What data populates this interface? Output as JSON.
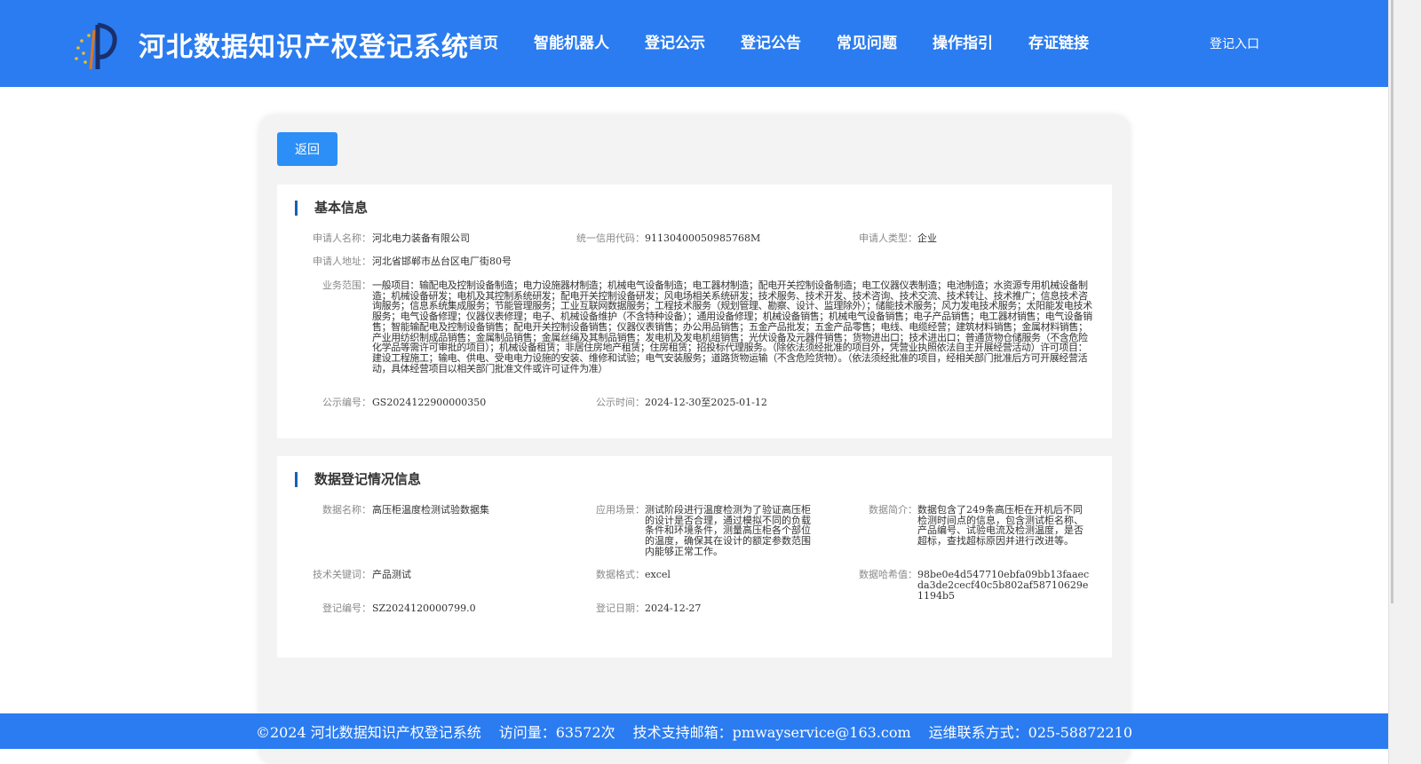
{
  "header": {
    "site_title": "河北数据知识产权登记系统",
    "nav": [
      "首页",
      "智能机器人",
      "登记公示",
      "登记公告",
      "常见问题",
      "操作指引",
      "存证链接"
    ],
    "login": "登记入口"
  },
  "back_button": "返回",
  "basic_info": {
    "title": "基本信息",
    "applicant_name": {
      "label": "申请人名称：",
      "value": "河北电力装备有限公司"
    },
    "credit_code": {
      "label": "统一信用代码：",
      "value": "91130400050985768M"
    },
    "applicant_type": {
      "label": "申请人类型：",
      "value": "企业"
    },
    "address": {
      "label": "申请人地址：",
      "value": "河北省邯郸市丛台区电厂街80号"
    },
    "business_scope": {
      "label": "业务范围：",
      "value": "一般项目：输配电及控制设备制造；电力设施器材制造；机械电气设备制造；电工器材制造；配电开关控制设备制造；电工仪器仪表制造；电池制造；水资源专用机械设备制造；机械设备研发；电机及其控制系统研发；配电开关控制设备研发；风电场相关系统研发；技术服务、技术开发、技术咨询、技术交流、技术转让、技术推广；信息技术咨询服务；信息系统集成服务；节能管理服务；工业互联网数据服务；工程技术服务（规划管理、勘察、设计、监理除外）；储能技术服务；风力发电技术服务；太阳能发电技术服务；电气设备修理；仪器仪表修理；电子、机械设备维护（不含特种设备）；通用设备修理；机械设备销售；机械电气设备销售；电子产品销售；电工器材销售；电气设备销售；智能输配电及控制设备销售；配电开关控制设备销售；仪器仪表销售；办公用品销售；五金产品批发；五金产品零售；电线、电缆经营；建筑材料销售；金属材料销售；产业用纺织制成品销售；金属制品销售；金属丝绳及其制品销售；发电机及发电机组销售；光伏设备及元器件销售；货物进出口；技术进出口；普通货物仓储服务（不含危险化学品等需许可审批的项目）；机械设备租赁；非居住房地产租赁；住房租赁；招投标代理服务。（除依法须经批准的项目外，凭营业执照依法自主开展经营活动）许可项目：建设工程施工；输电、供电、受电电力设施的安装、维修和试验；电气安装服务；道路货物运输（不含危险货物）。（依法须经批准的项目，经相关部门批准后方可开展经营活动，具体经营项目以相关部门批准文件或许可证件为准）"
    },
    "notice_no": {
      "label": "公示编号：",
      "value": "GS2024122900000350"
    },
    "notice_time": {
      "label": "公示时间：",
      "value": "2024-12-30至2025-01-12"
    }
  },
  "data_info": {
    "title": "数据登记情况信息",
    "data_name": {
      "label": "数据名称：",
      "value": "高压柜温度检测试验数据集"
    },
    "scenario": {
      "label": "应用场景：",
      "value": "测试阶段进行温度检测为了验证高压柜的设计是否合理，通过模拟不同的负载条件和环境条件，测量高压柜各个部位的温度，确保其在设计的额定参数范围内能够正常工作。"
    },
    "summary": {
      "label": "数据简介：",
      "value": "数据包含了249条高压柜在开机后不同检测时间点的信息，包含测试柜名称、产品编号、试验电流及检测温度，是否超标，查找超标原因并进行改进等。"
    },
    "keywords": {
      "label": "技术关键词：",
      "value": "产品测试"
    },
    "format": {
      "label": "数据格式：",
      "value": "excel"
    },
    "hash": {
      "label": "数据哈希值：",
      "value": "98be0e4d547710ebfa09bb13faaecda3de2cecf40c5b802af58710629e1194b5"
    },
    "reg_no": {
      "label": "登记编号：",
      "value": "SZ2024120000799.0"
    },
    "reg_date": {
      "label": "登记日期：",
      "value": "2024-12-27"
    }
  },
  "footer": {
    "copyright": "©2024 河北数据知识产权登记系统",
    "visits": "访问量：63572次",
    "email": "技术支持邮箱：pmwayservice@163.com",
    "phone": "运维联系方式：025-58872210"
  },
  "colors": {
    "primary": "#2b7cf0",
    "button": "#2b8ff7",
    "title_bar": "#1a5fb4"
  }
}
